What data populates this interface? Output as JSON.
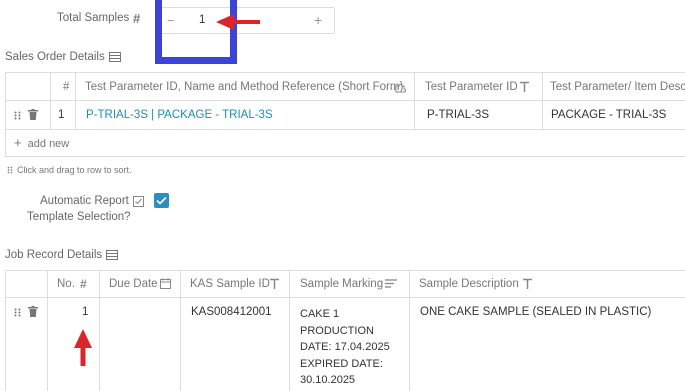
{
  "total_samples": {
    "label": "Total Samples",
    "hash": "#",
    "minus": "−",
    "value": "1",
    "plus": "+"
  },
  "sales_order": {
    "title": "Sales Order Details",
    "columns": {
      "num": "#",
      "param_ref": "Test Parameter ID, Name and Method Reference (Short Form)",
      "param_id": "Test Parameter ID",
      "item_desc": "Test Parameter/ Item Descr"
    },
    "rows": [
      {
        "num": "1",
        "param_ref": "P-TRIAL-3S | PACKAGE - TRIAL-3S",
        "param_id": "P-TRIAL-3S",
        "item_desc": "PACKAGE - TRIAL-3S"
      }
    ],
    "add_new": "add new",
    "drag_hint": "Click and drag to row to sort."
  },
  "auto_report": {
    "label_line1": "Automatic Report",
    "label_line2": "Template Selection?",
    "checked": true
  },
  "job_record": {
    "title": "Job Record Details",
    "columns": {
      "no": "No.",
      "due_date": "Due Date",
      "kas_id": "KAS Sample ID",
      "marking": "Sample Marking",
      "desc": "Sample Description"
    },
    "rows": [
      {
        "no": "1",
        "due_date": "",
        "kas_id": "KAS008412001",
        "marking_lines": [
          "CAKE 1",
          "PRODUCTION",
          "DATE: 17.04.2025",
          "EXPIRED DATE:",
          "30.10.2025"
        ],
        "desc": "ONE CAKE SAMPLE (SEALED IN PLASTIC)"
      }
    ]
  },
  "colors": {
    "highlight": "#3b44d6",
    "arrow": "#d9262b",
    "accent": "#2a8fbd",
    "link": "#1a8fb0"
  }
}
